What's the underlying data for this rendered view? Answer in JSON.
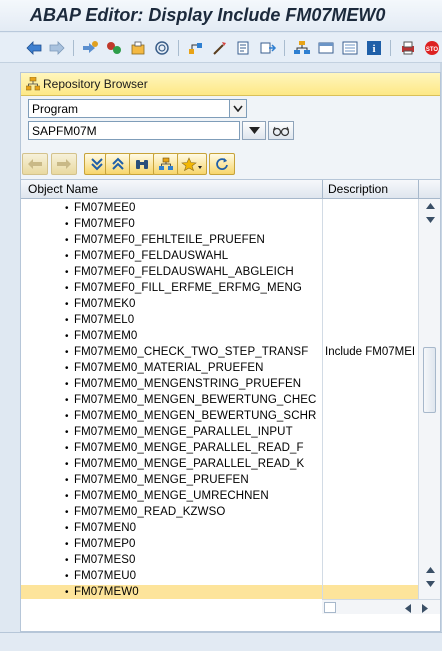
{
  "window": {
    "title": "ABAP Editor: Display Include FM07MEW0"
  },
  "toolbar": {
    "buttons": [
      {
        "name": "back-arrow-icon"
      },
      {
        "name": "forward-arrow-icon"
      },
      {
        "name": "display-change-icon"
      },
      {
        "name": "active-inactive-icon"
      },
      {
        "name": "other-object-icon"
      },
      {
        "name": "check-icon"
      },
      {
        "name": "activate-icon"
      },
      {
        "name": "test-icon"
      },
      {
        "name": "where-used-icon"
      },
      {
        "name": "object-list-icon"
      },
      {
        "name": "hierarchy-icon"
      },
      {
        "name": "navigation-window-icon"
      },
      {
        "name": "info-icon"
      },
      {
        "name": "pattern-icon"
      },
      {
        "name": "pretty-printer-icon"
      }
    ]
  },
  "repository_browser": {
    "title": "Repository Browser",
    "object_type": "Program",
    "object_name": "SAPFM07M"
  },
  "tree": {
    "columns": {
      "name": "Object Name",
      "description": "Description"
    },
    "rows": [
      {
        "name": "FM07MEE0",
        "desc": ""
      },
      {
        "name": "FM07MEF0",
        "desc": ""
      },
      {
        "name": "FM07MEF0_FEHLTEILE_PRUEFEN",
        "desc": ""
      },
      {
        "name": "FM07MEF0_FELDAUSWAHL",
        "desc": ""
      },
      {
        "name": "FM07MEF0_FELDAUSWAHL_ABGLEICH",
        "desc": ""
      },
      {
        "name": "FM07MEF0_FILL_ERFME_ERFMG_MENG",
        "desc": ""
      },
      {
        "name": "FM07MEK0",
        "desc": ""
      },
      {
        "name": "FM07MEL0",
        "desc": ""
      },
      {
        "name": "FM07MEM0",
        "desc": ""
      },
      {
        "name": "FM07MEM0_CHECK_TWO_STEP_TRANSF",
        "desc": "Include FM07MEI"
      },
      {
        "name": "FM07MEM0_MATERIAL_PRUEFEN",
        "desc": ""
      },
      {
        "name": "FM07MEM0_MENGENSTRING_PRUEFEN",
        "desc": ""
      },
      {
        "name": "FM07MEM0_MENGEN_BEWERTUNG_CHEC",
        "desc": ""
      },
      {
        "name": "FM07MEM0_MENGEN_BEWERTUNG_SCHR",
        "desc": ""
      },
      {
        "name": "FM07MEM0_MENGE_PARALLEL_INPUT",
        "desc": ""
      },
      {
        "name": "FM07MEM0_MENGE_PARALLEL_READ_F",
        "desc": ""
      },
      {
        "name": "FM07MEM0_MENGE_PARALLEL_READ_K",
        "desc": ""
      },
      {
        "name": "FM07MEM0_MENGE_PRUEFEN",
        "desc": ""
      },
      {
        "name": "FM07MEM0_MENGE_UMRECHNEN",
        "desc": ""
      },
      {
        "name": "FM07MEM0_READ_KZWSO",
        "desc": ""
      },
      {
        "name": "FM07MEN0",
        "desc": ""
      },
      {
        "name": "FM07MEP0",
        "desc": ""
      },
      {
        "name": "FM07MES0",
        "desc": ""
      },
      {
        "name": "FM07MEU0",
        "desc": ""
      },
      {
        "name": "FM07MEW0",
        "desc": "",
        "selected": true
      }
    ]
  }
}
